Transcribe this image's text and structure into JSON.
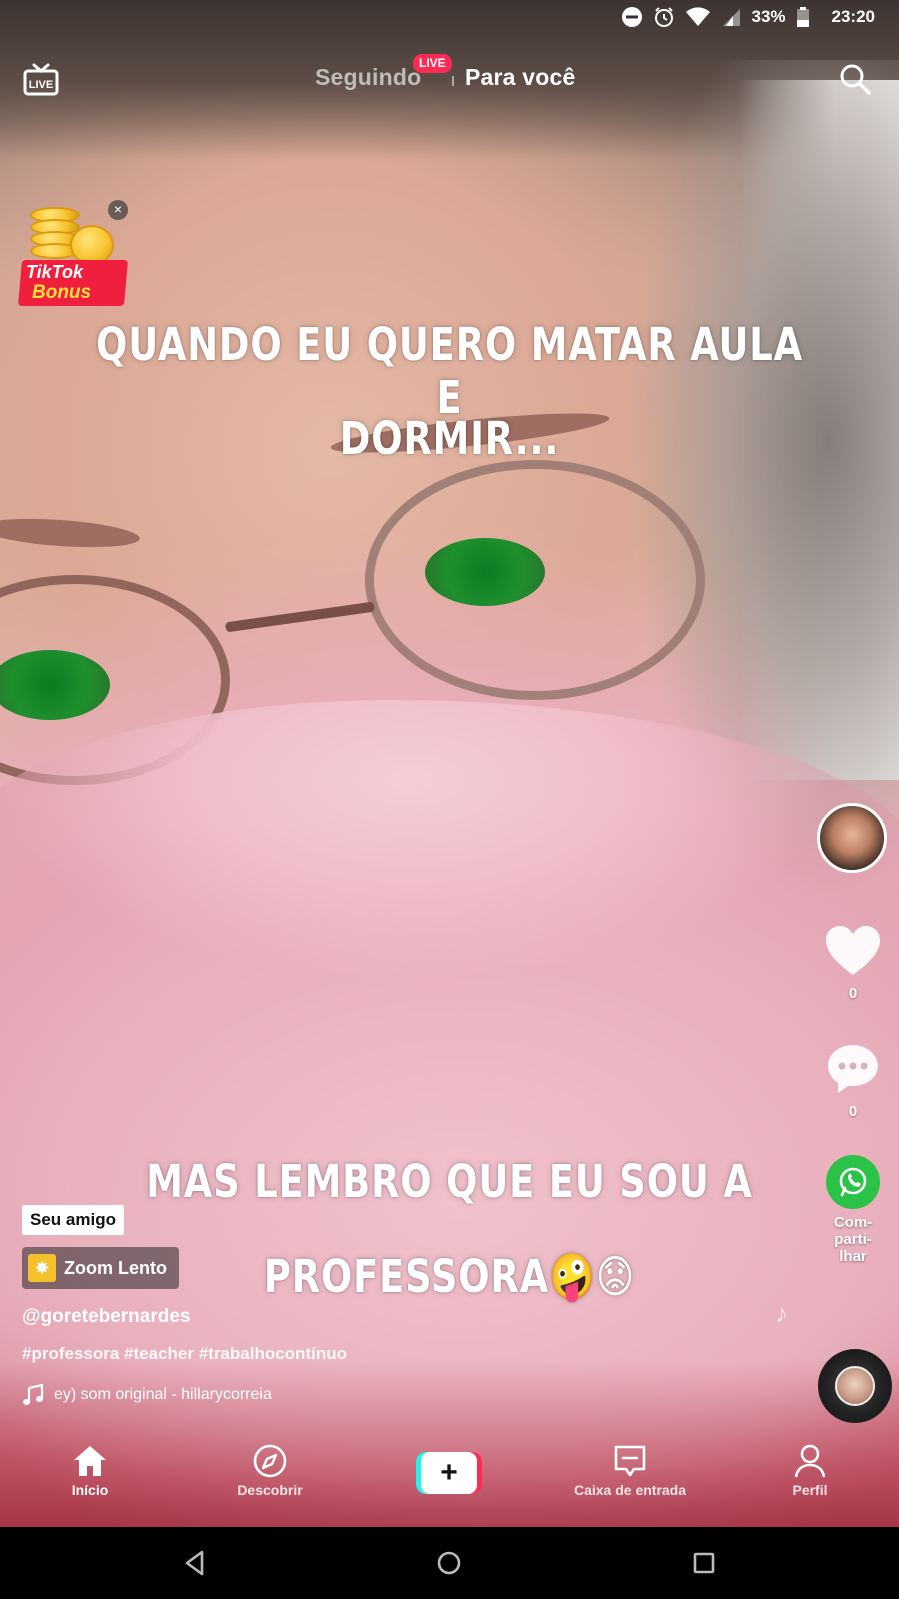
{
  "status_bar": {
    "battery": "33%",
    "time": "23:20",
    "icons": [
      "do-not-disturb-icon",
      "alarm-icon",
      "wifi-icon",
      "signal-icon",
      "battery-icon"
    ]
  },
  "top_nav": {
    "live_icon_label": "LIVE",
    "following": "Seguindo",
    "live_badge": "LIVE",
    "for_you": "Para você"
  },
  "bonus": {
    "line1": "TikTok",
    "line2": "Bonus",
    "close": "×"
  },
  "captions": {
    "line1": "QUANDO EU QUERO MATAR AULA E",
    "line2": "DORMIR...",
    "line3": "MAS LEMBRO QUE EU SOU A",
    "line4": "PROFESSORA🤪😟"
  },
  "actions": {
    "likes": "0",
    "comments": "0",
    "share_label_1": "Com-",
    "share_label_2": "parti-",
    "share_label_3": "lhar"
  },
  "info": {
    "friend_tag": "Seu amigo",
    "effect": "Zoom Lento",
    "username": "@goretebernardes",
    "hashtags": "#professora #teacher #trabalhocontínuo",
    "sound": "ey)    som original - hillarycorreia"
  },
  "tabbar": {
    "home": "Início",
    "discover": "Descobrir",
    "create": "+",
    "inbox": "Caixa de entrada",
    "profile": "Perfil"
  },
  "colors": {
    "live_red": "#fe2c55",
    "create_cyan": "#25f4ee",
    "whatsapp_green": "#2ac247",
    "bonus_red": "#ef1f3d",
    "bonus_yellow": "#ffe13b"
  }
}
